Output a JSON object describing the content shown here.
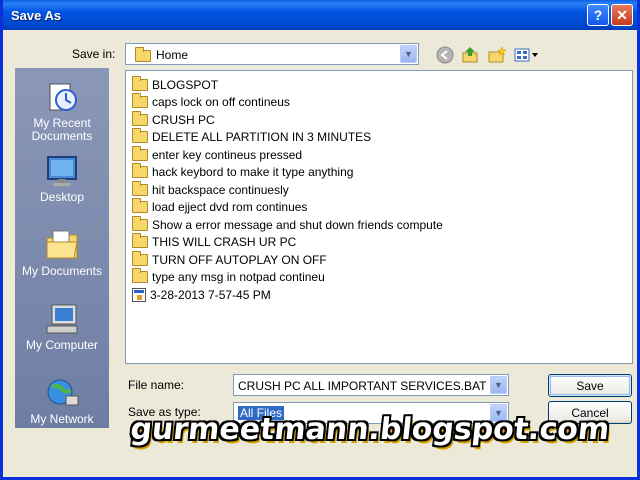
{
  "window": {
    "title": "Save As",
    "help_glyph": "?",
    "close_glyph": "✕"
  },
  "save_in": {
    "label": "Save in:",
    "value": "Home"
  },
  "places": [
    {
      "label": "My Recent Documents",
      "icon": "recent-documents-icon"
    },
    {
      "label": "Desktop",
      "icon": "desktop-icon"
    },
    {
      "label": "My Documents",
      "icon": "my-documents-icon"
    },
    {
      "label": "My Computer",
      "icon": "my-computer-icon"
    },
    {
      "label": "My Network",
      "icon": "my-network-icon"
    }
  ],
  "files": [
    {
      "name": "BLOGSPOT",
      "type": "folder"
    },
    {
      "name": "caps lock on off contineus",
      "type": "folder"
    },
    {
      "name": "CRUSH PC",
      "type": "folder"
    },
    {
      "name": "DELETE ALL PARTITION IN 3 MINUTES",
      "type": "folder"
    },
    {
      "name": "enter key contineus pressed",
      "type": "folder"
    },
    {
      "name": "hack keybord to make it type anything",
      "type": "folder"
    },
    {
      "name": "hit backspace continuesly",
      "type": "folder"
    },
    {
      "name": "load ejject dvd rom continues",
      "type": "folder"
    },
    {
      "name": "Show a error message and shut down friends compute",
      "type": "folder"
    },
    {
      "name": "THIS WILL CRASH UR PC",
      "type": "folder"
    },
    {
      "name": "TURN OFF AUTOPLAY ON OFF",
      "type": "folder"
    },
    {
      "name": "type any msg in notpad contineu",
      "type": "folder"
    },
    {
      "name": "3-28-2013 7-57-45 PM",
      "type": "file"
    }
  ],
  "file_name": {
    "label": "File name:",
    "value": "CRUSH PC ALL IMPORTANT SERVICES.BAT"
  },
  "save_as_type": {
    "label": "Save as type:",
    "value": "All Files"
  },
  "buttons": {
    "save": "Save",
    "cancel": "Cancel"
  },
  "watermark": "gurmeetmann.blogspot.com",
  "colors": {
    "titlebar": "#0054e3",
    "dialog_bg": "#ece9d8",
    "selection": "#316ac5"
  }
}
